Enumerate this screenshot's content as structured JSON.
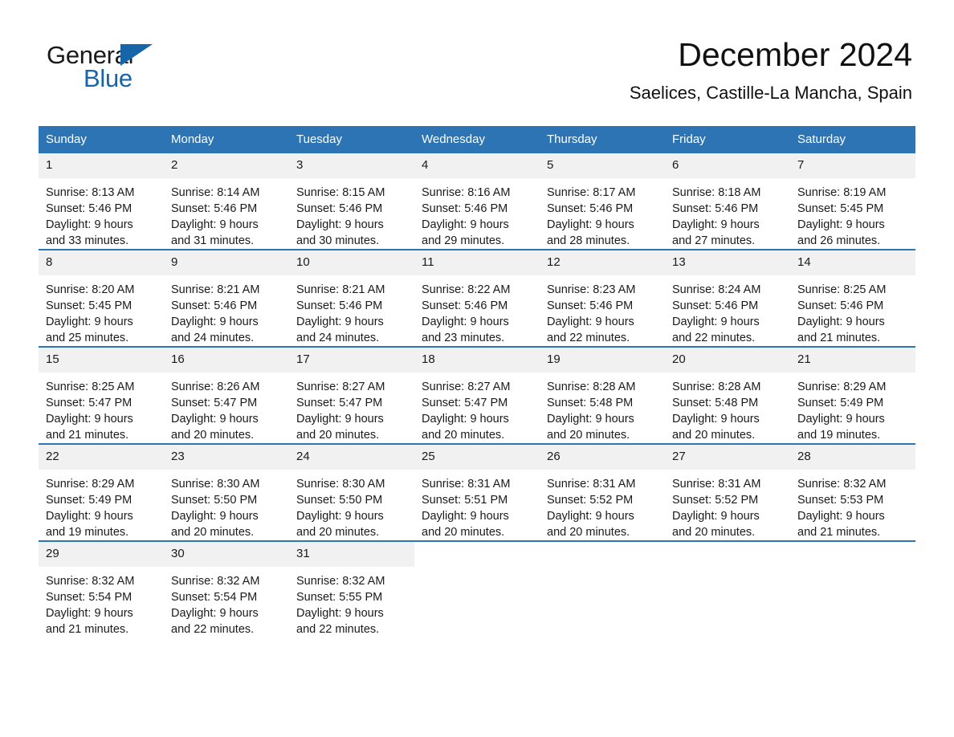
{
  "brand": {
    "name_part1": "General",
    "name_part2": "Blue",
    "logo_color": "#1565a8"
  },
  "header": {
    "month_title": "December 2024",
    "location": "Saelices, Castille-La Mancha, Spain"
  },
  "theme": {
    "header_bg": "#2c74b3",
    "header_text": "#ffffff",
    "daynum_bg": "#f1f1f1",
    "row_divider": "#2c74b3",
    "page_bg": "#ffffff",
    "body_text": "#1a1a1a"
  },
  "weekday_headers": [
    "Sunday",
    "Monday",
    "Tuesday",
    "Wednesday",
    "Thursday",
    "Friday",
    "Saturday"
  ],
  "weeks": [
    [
      {
        "day": "1",
        "sunrise": "Sunrise: 8:13 AM",
        "sunset": "Sunset: 5:46 PM",
        "daylight_line1": "Daylight: 9 hours",
        "daylight_line2": "and 33 minutes."
      },
      {
        "day": "2",
        "sunrise": "Sunrise: 8:14 AM",
        "sunset": "Sunset: 5:46 PM",
        "daylight_line1": "Daylight: 9 hours",
        "daylight_line2": "and 31 minutes."
      },
      {
        "day": "3",
        "sunrise": "Sunrise: 8:15 AM",
        "sunset": "Sunset: 5:46 PM",
        "daylight_line1": "Daylight: 9 hours",
        "daylight_line2": "and 30 minutes."
      },
      {
        "day": "4",
        "sunrise": "Sunrise: 8:16 AM",
        "sunset": "Sunset: 5:46 PM",
        "daylight_line1": "Daylight: 9 hours",
        "daylight_line2": "and 29 minutes."
      },
      {
        "day": "5",
        "sunrise": "Sunrise: 8:17 AM",
        "sunset": "Sunset: 5:46 PM",
        "daylight_line1": "Daylight: 9 hours",
        "daylight_line2": "and 28 minutes."
      },
      {
        "day": "6",
        "sunrise": "Sunrise: 8:18 AM",
        "sunset": "Sunset: 5:46 PM",
        "daylight_line1": "Daylight: 9 hours",
        "daylight_line2": "and 27 minutes."
      },
      {
        "day": "7",
        "sunrise": "Sunrise: 8:19 AM",
        "sunset": "Sunset: 5:45 PM",
        "daylight_line1": "Daylight: 9 hours",
        "daylight_line2": "and 26 minutes."
      }
    ],
    [
      {
        "day": "8",
        "sunrise": "Sunrise: 8:20 AM",
        "sunset": "Sunset: 5:45 PM",
        "daylight_line1": "Daylight: 9 hours",
        "daylight_line2": "and 25 minutes."
      },
      {
        "day": "9",
        "sunrise": "Sunrise: 8:21 AM",
        "sunset": "Sunset: 5:46 PM",
        "daylight_line1": "Daylight: 9 hours",
        "daylight_line2": "and 24 minutes."
      },
      {
        "day": "10",
        "sunrise": "Sunrise: 8:21 AM",
        "sunset": "Sunset: 5:46 PM",
        "daylight_line1": "Daylight: 9 hours",
        "daylight_line2": "and 24 minutes."
      },
      {
        "day": "11",
        "sunrise": "Sunrise: 8:22 AM",
        "sunset": "Sunset: 5:46 PM",
        "daylight_line1": "Daylight: 9 hours",
        "daylight_line2": "and 23 minutes."
      },
      {
        "day": "12",
        "sunrise": "Sunrise: 8:23 AM",
        "sunset": "Sunset: 5:46 PM",
        "daylight_line1": "Daylight: 9 hours",
        "daylight_line2": "and 22 minutes."
      },
      {
        "day": "13",
        "sunrise": "Sunrise: 8:24 AM",
        "sunset": "Sunset: 5:46 PM",
        "daylight_line1": "Daylight: 9 hours",
        "daylight_line2": "and 22 minutes."
      },
      {
        "day": "14",
        "sunrise": "Sunrise: 8:25 AM",
        "sunset": "Sunset: 5:46 PM",
        "daylight_line1": "Daylight: 9 hours",
        "daylight_line2": "and 21 minutes."
      }
    ],
    [
      {
        "day": "15",
        "sunrise": "Sunrise: 8:25 AM",
        "sunset": "Sunset: 5:47 PM",
        "daylight_line1": "Daylight: 9 hours",
        "daylight_line2": "and 21 minutes."
      },
      {
        "day": "16",
        "sunrise": "Sunrise: 8:26 AM",
        "sunset": "Sunset: 5:47 PM",
        "daylight_line1": "Daylight: 9 hours",
        "daylight_line2": "and 20 minutes."
      },
      {
        "day": "17",
        "sunrise": "Sunrise: 8:27 AM",
        "sunset": "Sunset: 5:47 PM",
        "daylight_line1": "Daylight: 9 hours",
        "daylight_line2": "and 20 minutes."
      },
      {
        "day": "18",
        "sunrise": "Sunrise: 8:27 AM",
        "sunset": "Sunset: 5:47 PM",
        "daylight_line1": "Daylight: 9 hours",
        "daylight_line2": "and 20 minutes."
      },
      {
        "day": "19",
        "sunrise": "Sunrise: 8:28 AM",
        "sunset": "Sunset: 5:48 PM",
        "daylight_line1": "Daylight: 9 hours",
        "daylight_line2": "and 20 minutes."
      },
      {
        "day": "20",
        "sunrise": "Sunrise: 8:28 AM",
        "sunset": "Sunset: 5:48 PM",
        "daylight_line1": "Daylight: 9 hours",
        "daylight_line2": "and 20 minutes."
      },
      {
        "day": "21",
        "sunrise": "Sunrise: 8:29 AM",
        "sunset": "Sunset: 5:49 PM",
        "daylight_line1": "Daylight: 9 hours",
        "daylight_line2": "and 19 minutes."
      }
    ],
    [
      {
        "day": "22",
        "sunrise": "Sunrise: 8:29 AM",
        "sunset": "Sunset: 5:49 PM",
        "daylight_line1": "Daylight: 9 hours",
        "daylight_line2": "and 19 minutes."
      },
      {
        "day": "23",
        "sunrise": "Sunrise: 8:30 AM",
        "sunset": "Sunset: 5:50 PM",
        "daylight_line1": "Daylight: 9 hours",
        "daylight_line2": "and 20 minutes."
      },
      {
        "day": "24",
        "sunrise": "Sunrise: 8:30 AM",
        "sunset": "Sunset: 5:50 PM",
        "daylight_line1": "Daylight: 9 hours",
        "daylight_line2": "and 20 minutes."
      },
      {
        "day": "25",
        "sunrise": "Sunrise: 8:31 AM",
        "sunset": "Sunset: 5:51 PM",
        "daylight_line1": "Daylight: 9 hours",
        "daylight_line2": "and 20 minutes."
      },
      {
        "day": "26",
        "sunrise": "Sunrise: 8:31 AM",
        "sunset": "Sunset: 5:52 PM",
        "daylight_line1": "Daylight: 9 hours",
        "daylight_line2": "and 20 minutes."
      },
      {
        "day": "27",
        "sunrise": "Sunrise: 8:31 AM",
        "sunset": "Sunset: 5:52 PM",
        "daylight_line1": "Daylight: 9 hours",
        "daylight_line2": "and 20 minutes."
      },
      {
        "day": "28",
        "sunrise": "Sunrise: 8:32 AM",
        "sunset": "Sunset: 5:53 PM",
        "daylight_line1": "Daylight: 9 hours",
        "daylight_line2": "and 21 minutes."
      }
    ],
    [
      {
        "day": "29",
        "sunrise": "Sunrise: 8:32 AM",
        "sunset": "Sunset: 5:54 PM",
        "daylight_line1": "Daylight: 9 hours",
        "daylight_line2": "and 21 minutes."
      },
      {
        "day": "30",
        "sunrise": "Sunrise: 8:32 AM",
        "sunset": "Sunset: 5:54 PM",
        "daylight_line1": "Daylight: 9 hours",
        "daylight_line2": "and 22 minutes."
      },
      {
        "day": "31",
        "sunrise": "Sunrise: 8:32 AM",
        "sunset": "Sunset: 5:55 PM",
        "daylight_line1": "Daylight: 9 hours",
        "daylight_line2": "and 22 minutes."
      },
      {
        "day": "",
        "sunrise": "",
        "sunset": "",
        "daylight_line1": "",
        "daylight_line2": ""
      },
      {
        "day": "",
        "sunrise": "",
        "sunset": "",
        "daylight_line1": "",
        "daylight_line2": ""
      },
      {
        "day": "",
        "sunrise": "",
        "sunset": "",
        "daylight_line1": "",
        "daylight_line2": ""
      },
      {
        "day": "",
        "sunrise": "",
        "sunset": "",
        "daylight_line1": "",
        "daylight_line2": ""
      }
    ]
  ]
}
